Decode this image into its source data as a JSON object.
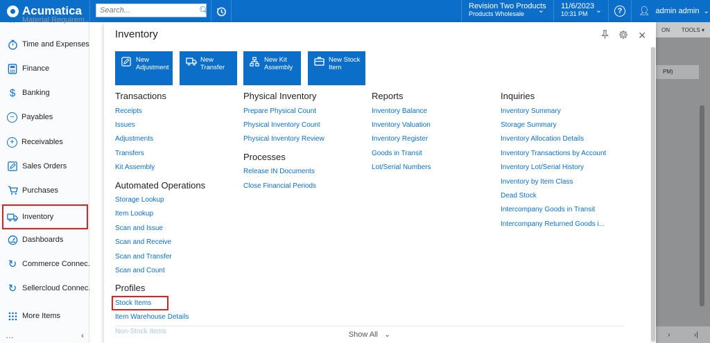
{
  "topbar": {
    "logo": "Acumatica",
    "search_placeholder": "Search...",
    "tenant_name": "Revision Two Products",
    "tenant_branch": "Products Wholesale",
    "date": "11/6/2023",
    "time": "10:31 PM",
    "user": "admin admin"
  },
  "sidebar": {
    "items": [
      {
        "label": "Time and Expenses",
        "icon": "timer-icon"
      },
      {
        "label": "Finance",
        "icon": "calculator-icon"
      },
      {
        "label": "Banking",
        "icon": "dollar-icon"
      },
      {
        "label": "Payables",
        "icon": "minus-circle-icon"
      },
      {
        "label": "Receivables",
        "icon": "plus-circle-icon"
      },
      {
        "label": "Sales Orders",
        "icon": "edit-icon"
      },
      {
        "label": "Purchases",
        "icon": "cart-icon"
      },
      {
        "label": "Inventory",
        "icon": "truck-icon"
      },
      {
        "label": "Dashboards",
        "icon": "gauge-icon"
      },
      {
        "label": "Commerce Connec...",
        "icon": "sync-icon"
      },
      {
        "label": "Sellercloud Connec...",
        "icon": "sync-icon"
      },
      {
        "label": "More Items",
        "icon": "grid-icon"
      }
    ],
    "top_partial": "Material Requirem..."
  },
  "background": {
    "header_left": "ON",
    "header_right": "TOOLS",
    "field_text": "PM)"
  },
  "panel": {
    "title": "Inventory",
    "quick_actions": [
      {
        "line1": "New",
        "line2": "Adjustment",
        "icon": "edit-icon"
      },
      {
        "line1": "New",
        "line2": "Transfer",
        "icon": "truck-icon"
      },
      {
        "line1": "New Kit",
        "line2": "Assembly",
        "icon": "hierarchy-icon"
      },
      {
        "line1": "New Stock",
        "line2": "Item",
        "icon": "box-icon"
      }
    ],
    "transactions": {
      "title": "Transactions",
      "links": [
        "Receipts",
        "Issues",
        "Adjustments",
        "Transfers",
        "Kit Assembly"
      ]
    },
    "automated": {
      "title": "Automated Operations",
      "links": [
        "Storage Lookup",
        "Item Lookup",
        "Scan and Issue",
        "Scan and Receive",
        "Scan and Transfer",
        "Scan and Count"
      ]
    },
    "profiles": {
      "title": "Profiles",
      "links": [
        "Stock Items",
        "Item Warehouse Details",
        "Non-Stock Items"
      ]
    },
    "physical": {
      "title": "Physical Inventory",
      "links": [
        "Prepare Physical Count",
        "Physical Inventory Count",
        "Physical Inventory Review"
      ]
    },
    "processes": {
      "title": "Processes",
      "links": [
        "Release IN Documents",
        "Close Financial Periods"
      ]
    },
    "reports": {
      "title": "Reports",
      "links": [
        "Inventory Balance",
        "Inventory Valuation",
        "Inventory Register",
        "Goods in Transit",
        "Lot/Serial Numbers"
      ]
    },
    "inquiries": {
      "title": "Inquiries",
      "links": [
        "Inventory Summary",
        "Storage Summary",
        "Inventory Allocation Details",
        "Inventory Transactions by Account",
        "Inventory Lot/Serial History",
        "Inventory by Item Class",
        "Dead Stock",
        "Intercompany Goods in Transit",
        "Intercompany Returned Goods i..."
      ]
    },
    "show_all": "Show All"
  },
  "colors": {
    "brand": "#0b6ec9",
    "highlight": "#e41f1f"
  }
}
